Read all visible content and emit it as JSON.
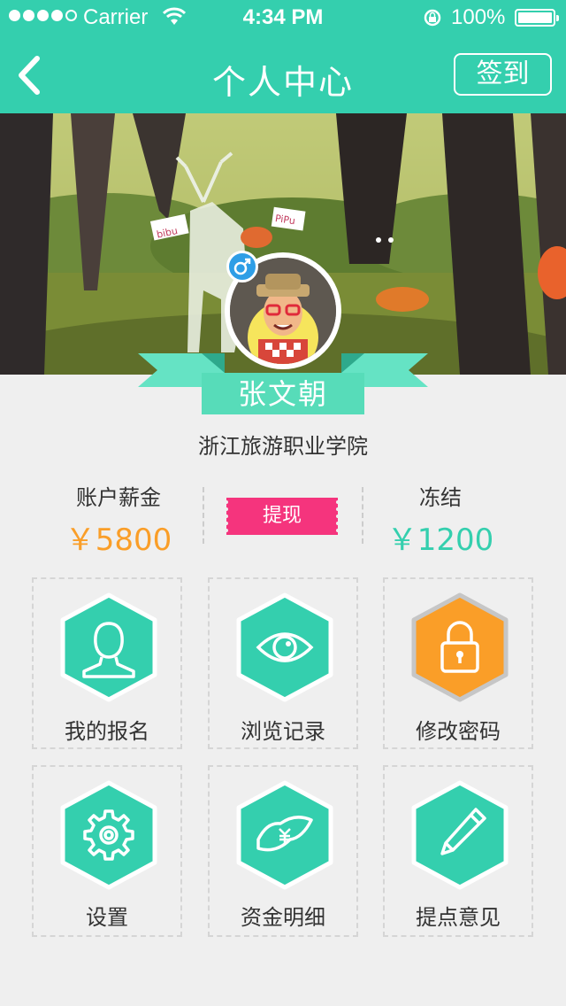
{
  "status_bar": {
    "carrier": "Carrier",
    "time": "4:34 PM",
    "battery": "100%"
  },
  "nav": {
    "title": "个人中心",
    "signin_label": "签到"
  },
  "banner": {
    "sign_left": "bibu",
    "sign_right": "PiPu"
  },
  "profile": {
    "name": "张文朝",
    "school": "浙江旅游职业学院",
    "gender": "male"
  },
  "balance": {
    "account_label": "账户薪金",
    "account_value": "￥5800",
    "withdraw_label": "提现",
    "frozen_label": "冻结",
    "frozen_value": "￥1200"
  },
  "menu": [
    {
      "label": "我的报名",
      "icon": "user-icon"
    },
    {
      "label": "浏览记录",
      "icon": "eye-icon"
    },
    {
      "label": "修改密码",
      "icon": "lock-icon"
    },
    {
      "label": "设置",
      "icon": "gear-icon"
    },
    {
      "label": "资金明细",
      "icon": "money-icon"
    },
    {
      "label": "提点意见",
      "icon": "pencil-icon"
    }
  ],
  "colors": {
    "primary": "#34cfae",
    "orange": "#fa9e28",
    "pink": "#f5347d",
    "blue": "#2e9ee6"
  }
}
